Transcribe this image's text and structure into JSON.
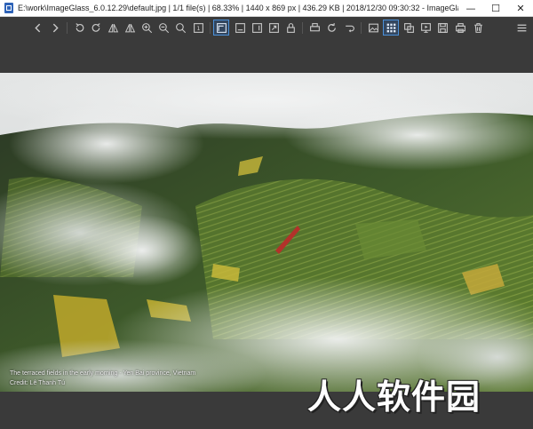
{
  "titlebar": {
    "text": "E:\\work\\ImageGlass_6.0.12.29\\default.jpg  |  1/1 file(s)  |  68.33%  |  1440 x 869 px  |  436.29 KB  |  2018/12/30 09:30:32  -  ImageGlass",
    "minimize": "—",
    "maximize": "☐",
    "close": "✕"
  },
  "toolbar": {
    "items": [
      "back-icon",
      "next-icon",
      "rotate-left-icon",
      "rotate-right-icon",
      "flip-horizontal-icon",
      "flip-vertical-icon",
      "zoom-in-icon",
      "zoom-out-icon",
      "zoom-to-fit-icon",
      "actual-size-icon",
      "lock-zoom-icon",
      "scale-width-icon",
      "scale-height-icon",
      "auto-zoom-icon",
      "lock-icon",
      "print-icon",
      "refresh-icon",
      "go-to-icon",
      "thumbnail-icon",
      "checkerboard-icon",
      "fullscreen-icon",
      "slideshow-icon",
      "convert-icon",
      "save-icon",
      "delete-icon",
      "menu-icon"
    ]
  },
  "photo": {
    "caption_line1": "The terraced fields in the early morning - Yen Bai province, Vietnam",
    "caption_line2": "Credit: Lê Thanh Tú"
  },
  "watermark": "人人软件园",
  "colors": {
    "background": "#3a3a3a",
    "accent": "#4a90d9"
  }
}
